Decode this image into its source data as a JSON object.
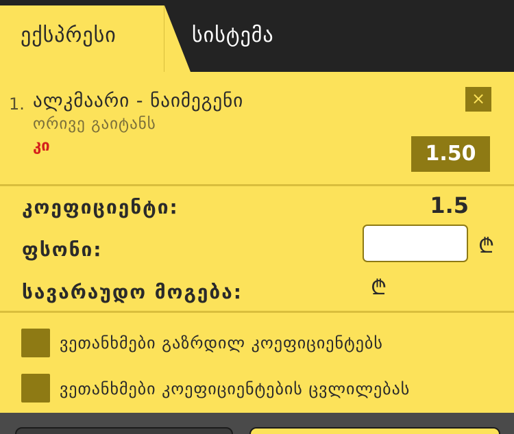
{
  "tabs": {
    "express": "ექსპრესი",
    "system": "სისტემა"
  },
  "bet": {
    "number": "1.",
    "match": "ალკმაარი - ნაიმეგენი",
    "market": "ორივე გაიტანს",
    "pick": "კი",
    "odd": "1.50",
    "close_icon": "×"
  },
  "summary": {
    "coefficient_label": "კოეფიციენტი:",
    "coefficient_value": "1.5",
    "stake_label": "ფსონი:",
    "stake_value": "",
    "currency_symbol": "₾",
    "potential_win_label": "სავარაუდო მოგება:"
  },
  "options": {
    "accept_increased": "ვეთანხმები გაზრდილ კოეფიციენტებს",
    "accept_changes": "ვეთანხმები კოეფიციენტების ცვლილებას"
  },
  "colors": {
    "accent_yellow": "#fce25a",
    "dark_olive": "#8e7a14",
    "pick_red": "#d4201c",
    "dark_bg": "#232323"
  }
}
